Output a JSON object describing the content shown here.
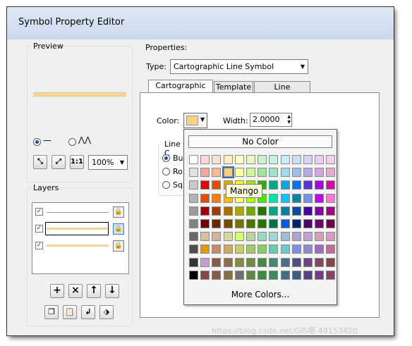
{
  "window": {
    "title": "Symbol Property Editor"
  },
  "preview": {
    "label": "Preview",
    "zoom": "100%",
    "line_color": "#f5d596"
  },
  "layers": {
    "label": "Layers",
    "items": [
      {
        "checked": true,
        "style": "thin"
      },
      {
        "checked": true,
        "style": "mango",
        "selected": true
      },
      {
        "checked": true,
        "style": "mango"
      }
    ]
  },
  "properties": {
    "label": "Properties:",
    "type_label": "Type:",
    "type_value": "Cartographic Line Symbol",
    "tabs": [
      {
        "label": "Cartographic Line",
        "active": true
      },
      {
        "label": "Template",
        "active": false
      },
      {
        "label": "Line Properties",
        "active": false
      }
    ],
    "color_label": "Color:",
    "color_value": "#fcd27c",
    "width_label": "Width:",
    "width_value": "2.0000",
    "line_caps_label": "Line C",
    "caps": [
      {
        "label": "Bu",
        "selected": true
      },
      {
        "label": "Ro",
        "selected": false
      },
      {
        "label": "Sq",
        "selected": false
      }
    ]
  },
  "color_popup": {
    "no_color": "No Color",
    "more_colors": "More Colors...",
    "tooltip": "Mango",
    "palette": [
      [
        "#ffffff",
        "#fdd7d7",
        "#fde0c9",
        "#fff1c2",
        "#ffffc2",
        "#e6f9c2",
        "#c9f2c9",
        "#c2f2e6",
        "#c9edf9",
        "#c9dcf9",
        "#d7d2f5",
        "#e6cdf5",
        "#f5cde6"
      ],
      [
        "#e1e1e1",
        "#f0a89d",
        "#f5b993",
        "#fccd7e",
        "#ffff9b",
        "#d2f59b",
        "#9be69b",
        "#9be6c8",
        "#9bdcf0",
        "#9bbeeb",
        "#b4aaeb",
        "#d2a5eb",
        "#eba5d2"
      ],
      [
        "#c8c8c8",
        "#e60000",
        "#e64c00",
        "#e6a800",
        "#ffff00",
        "#a8e600",
        "#38a800",
        "#00a884",
        "#00a9e6",
        "#0070ff",
        "#5c2ee6",
        "#a800e6",
        "#e600a9"
      ],
      [
        "#b4b4b4",
        "#e64c00",
        "#ff7f00",
        "#ffbe00",
        "#ffff73",
        "#aaff00",
        "#4ce600",
        "#00e6a9",
        "#00c5ff",
        "#0084a8",
        "#7a8ef5",
        "#c500ff",
        "#ff73df"
      ],
      [
        "#9c9c9c",
        "#a80000",
        "#a83800",
        "#a87000",
        "#a8a800",
        "#70a800",
        "#267300",
        "#00a884",
        "#0084a8",
        "#004da8",
        "#4c00a8",
        "#8400a8",
        "#a80084"
      ],
      [
        "#828282",
        "#730000",
        "#732600",
        "#734c00",
        "#737300",
        "#4c7300",
        "#267300",
        "#00734c",
        "#005ce6",
        "#002673",
        "#4c0073",
        "#730073",
        "#73004c"
      ],
      [
        "#686868",
        "#d7c29e",
        "#d7b09e",
        "#d7d79e",
        "#d1ff73",
        "#b4d79e",
        "#9ed7c2",
        "#9ed7d7",
        "#9ebbd7",
        "#a9a6d7",
        "#c29ed7",
        "#d69dbc",
        "#d79ec2"
      ],
      [
        "#4e4e4e",
        "#e69800",
        "#cd8966",
        "#cdaa66",
        "#cdcd66",
        "#a5c866",
        "#89cd66",
        "#66cdab",
        "#66cdcd",
        "#7a8ef5",
        "#8c8ccd",
        "#a866cd",
        "#cd6699"
      ],
      [
        "#343434",
        "#c29ed7",
        "#895a44",
        "#89704a",
        "#898944",
        "#708944",
        "#448944",
        "#448970",
        "#447089",
        "#4e4e89",
        "#70448a",
        "#894465",
        "#894444"
      ],
      [
        "#000000",
        "#894444",
        "#895a44",
        "#897044",
        "#6e6e6e",
        "#5c893e",
        "#3e893e",
        "#3e895c",
        "#3e7089",
        "#3e5c89",
        "#5c3e89",
        "#6e3e89",
        "#893e6e"
      ]
    ]
  },
  "watermark": "https://blog.csdn.net/GIS哪 49153420"
}
